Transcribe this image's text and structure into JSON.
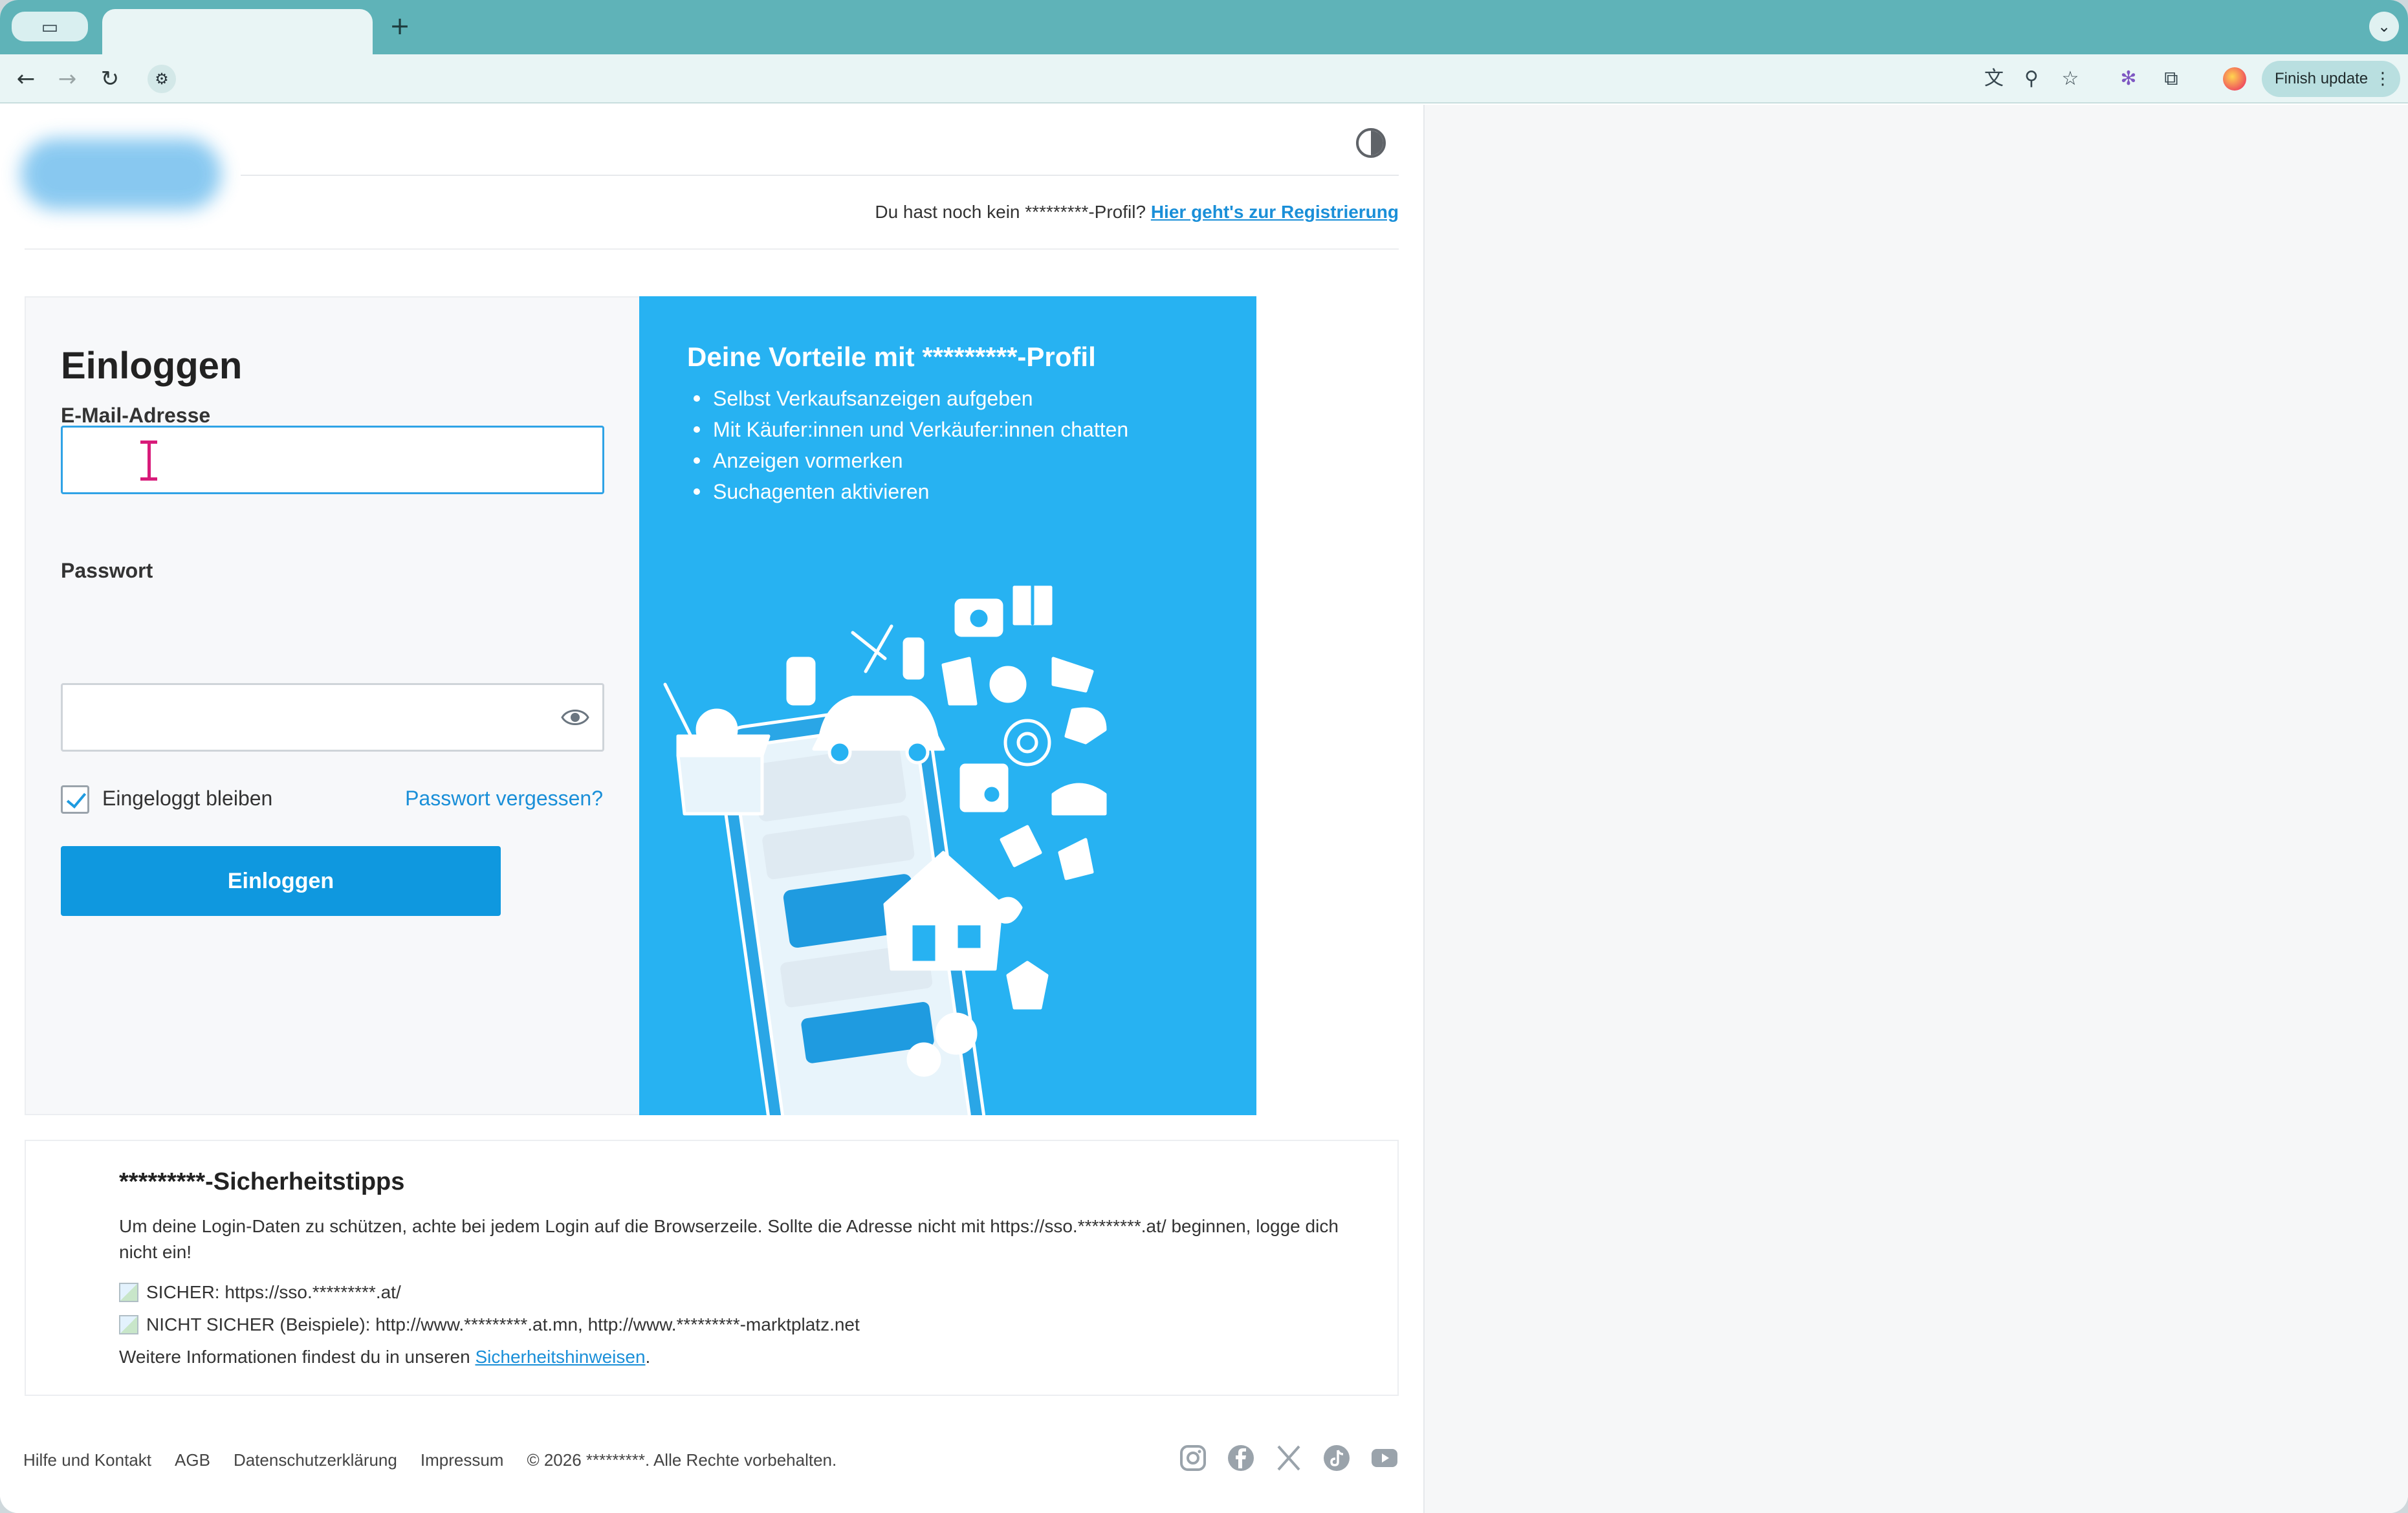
{
  "browser": {
    "tab_side_icon": "tab-search-icon",
    "new_tab_label": "+",
    "finish_update_label": "Finish update"
  },
  "header": {
    "register_prompt": "Du hast noch kein *********-Profil?",
    "register_link": "Hier geht's zur Registrierung"
  },
  "login": {
    "title": "Einloggen",
    "email_label": "E-Mail-Adresse",
    "email_value": "",
    "password_label": "Passwort",
    "password_value": "",
    "remember_label": "Eingeloggt bleiben",
    "remember_checked": true,
    "forgot_link": "Passwort vergessen?",
    "submit_label": "Einloggen"
  },
  "promo": {
    "title": "Deine Vorteile mit *********-Profil",
    "items": [
      "Selbst Verkaufsanzeigen aufgeben",
      "Mit Käufer:innen und Verkäufer:innen chatten",
      "Anzeigen vormerken",
      "Suchagenten aktivieren"
    ]
  },
  "tips": {
    "title": "*********-Sicherheitstipps",
    "body": "Um deine Login-Daten zu schützen, achte bei jedem Login auf die Browserzeile. Sollte die Adresse nicht mit https://sso.*********.at/ beginnen, logge dich nicht ein!",
    "safe": "SICHER: https://sso.*********.at/",
    "unsafe": "NICHT SICHER (Beispiele): http://www.*********.at.mn, http://www.*********-marktplatz.net",
    "more_prefix": "Weitere Informationen findest du in unseren ",
    "more_link": "Sicherheitshinweisen",
    "more_suffix": "."
  },
  "footer": {
    "links": [
      "Hilfe und Kontakt",
      "AGB",
      "Datenschutzerklärung",
      "Impressum"
    ],
    "copyright": "© 2026 *********. Alle Rechte vorbehalten.",
    "social_icons": [
      "instagram-icon",
      "facebook-icon",
      "x-icon",
      "tiktok-icon",
      "youtube-icon"
    ]
  },
  "colors": {
    "accent": "#0f98df",
    "promo_bg": "#27b2f2",
    "link": "#1a8fd8",
    "tabstrip": "#5fb3b8"
  }
}
